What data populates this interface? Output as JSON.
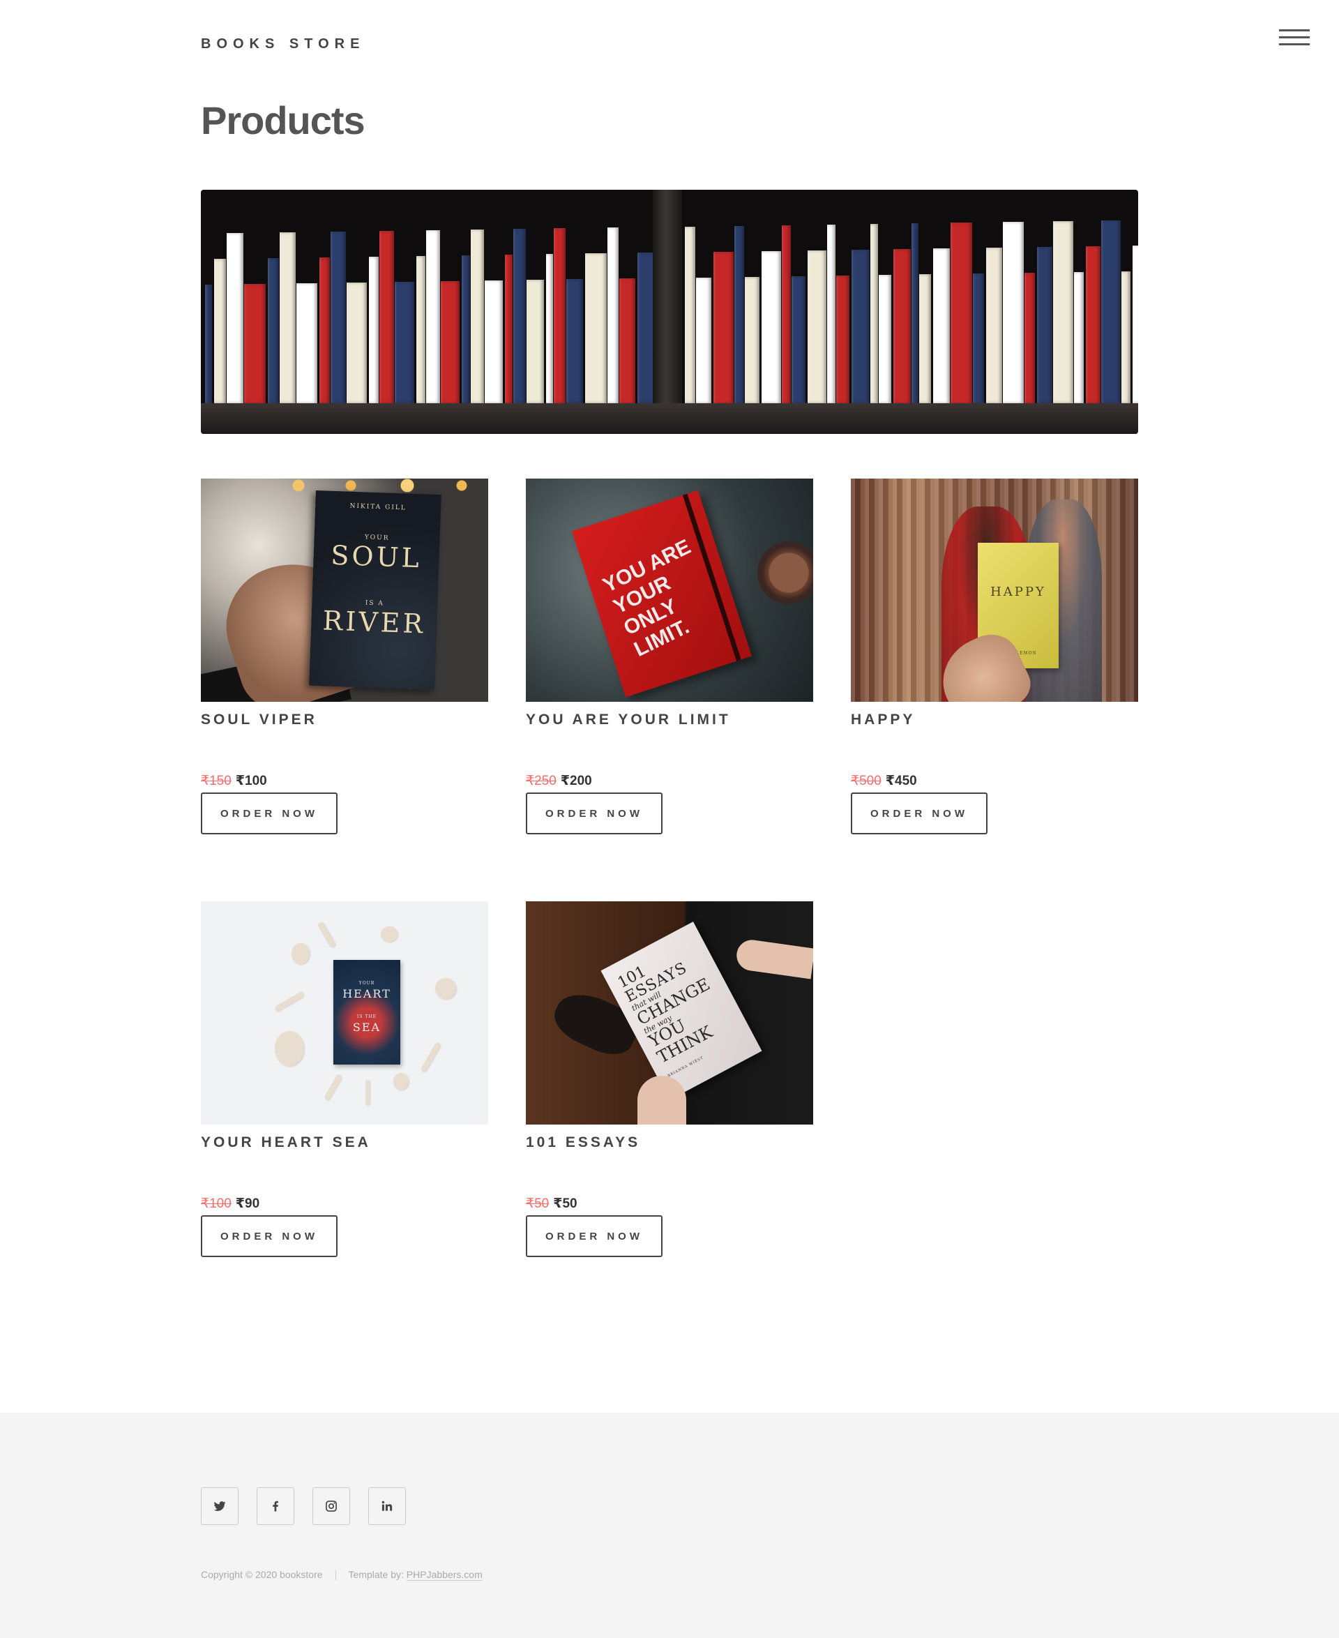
{
  "header": {
    "brand": "BOOKS STORE",
    "menu_icon": "hamburger-menu-icon"
  },
  "page": {
    "title": "Products"
  },
  "hero": {
    "image": "bookshelf-banner"
  },
  "products": [
    {
      "name": "SOUL VIPER",
      "old_price": "₹150",
      "price": "₹100",
      "button": "ORDER NOW",
      "cover": {
        "author": "NIKITA GILL",
        "line1": "YOUR",
        "title1": "SOUL",
        "line2": "IS A",
        "title2": "RIVER"
      }
    },
    {
      "name": "YOU ARE YOUR LIMIT",
      "old_price": "₹250",
      "price": "₹200",
      "button": "ORDER NOW",
      "cover": {
        "line1": "YOU ARE",
        "line2": "YOUR ONLY",
        "line3": "LIMIT."
      }
    },
    {
      "name": "HAPPY",
      "old_price": "₹500",
      "price": "₹450",
      "button": "ORDER NOW",
      "cover": {
        "title": "HAPPY",
        "author": "ALEX LEMON"
      }
    },
    {
      "name": "YOUR HEART SEA",
      "old_price": "₹100",
      "price": "₹90",
      "button": "ORDER NOW",
      "cover": {
        "line1": "YOUR",
        "title1": "HEART",
        "line2": "IS THE",
        "title2": "SEA"
      }
    },
    {
      "name": "101 ESSAYS",
      "old_price": "₹50",
      "price": "₹50",
      "button": "ORDER NOW",
      "cover": {
        "l1": "101",
        "l2": "ESSAYS",
        "l3": "that will",
        "l4": "CHANGE",
        "l5": "the way",
        "l6": "YOU",
        "l7": "THINK",
        "author": "BRIANNA WIEST"
      }
    }
  ],
  "footer": {
    "social": [
      {
        "name": "twitter",
        "icon": "twitter-icon"
      },
      {
        "name": "facebook",
        "icon": "facebook-icon"
      },
      {
        "name": "instagram",
        "icon": "instagram-icon"
      },
      {
        "name": "linkedin",
        "icon": "linkedin-icon"
      }
    ],
    "copyright": "Copyright © 2020 bookstore",
    "template_prefix": "Template by:",
    "template_link": "PHPJabbers.com"
  }
}
